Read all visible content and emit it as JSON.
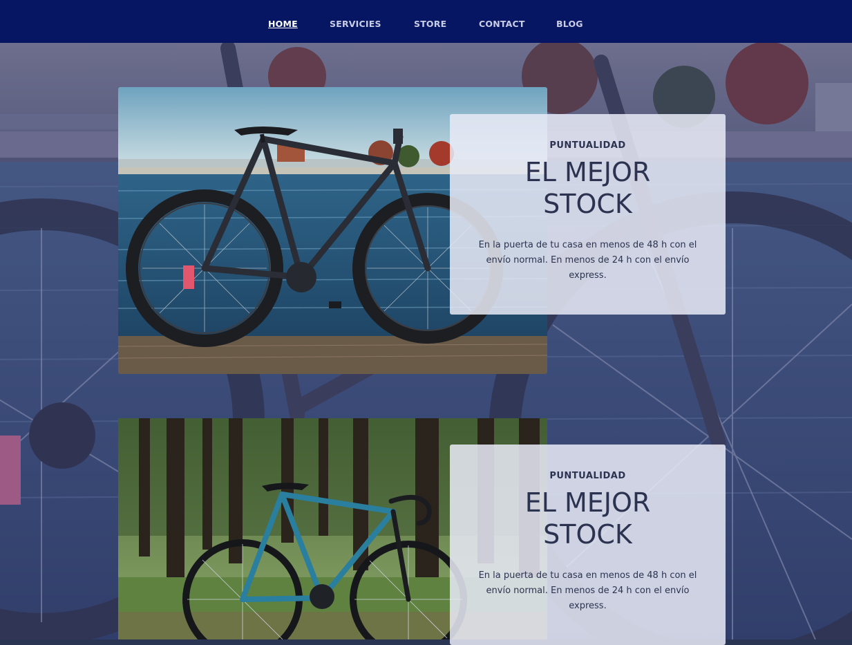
{
  "nav": {
    "items": [
      {
        "label": "HOME",
        "active": true
      },
      {
        "label": "SERVICIES",
        "active": false
      },
      {
        "label": "STORE",
        "active": false
      },
      {
        "label": "CONTACT",
        "active": false
      },
      {
        "label": "BLOG",
        "active": false
      }
    ]
  },
  "features": [
    {
      "kicker": "PUNTUALIDAD",
      "title_line1": "EL MEJOR",
      "title_line2": "STOCK",
      "description": "En la puerta de tu casa en menos de 48 h con el envío normal. En menos de 24 h con el envío express."
    },
    {
      "kicker": "PUNTUALIDAD",
      "title_line1": "EL MEJOR",
      "title_line2": "STOCK",
      "description": "En la puerta de tu casa en menos de 48 h con el envío normal. En menos de 24 h con el envío express."
    }
  ],
  "colors": {
    "nav_bg": "#061663",
    "card_text": "#2b3350",
    "card_bg": "#e8eaf6"
  }
}
